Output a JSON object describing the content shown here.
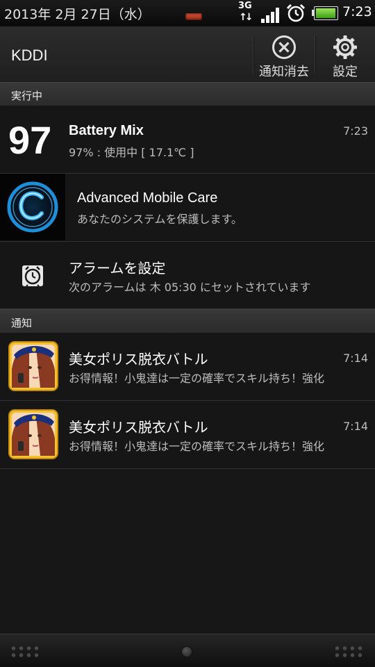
{
  "status_bar": {
    "date": "2013年 2月 27日（水）",
    "network_label": "3G",
    "time": "7:23",
    "battery_level": 0.97,
    "icons": [
      "notification-led-icon",
      "network-3g-icon",
      "signal-strength-icon",
      "alarm-clock-icon",
      "battery-icon"
    ]
  },
  "header": {
    "carrier": "KDDI",
    "clear_label": "通知消去",
    "settings_label": "設定"
  },
  "sections": {
    "running": "実行中",
    "notifications": "通知"
  },
  "running_items": [
    {
      "badge": "97",
      "title": "Battery Mix",
      "subtitle": "97% : 使用中 [ 17.1℃ ]",
      "time": "7:23"
    },
    {
      "title": "Advanced Mobile Care",
      "subtitle": "あなたのシステムを保護します。",
      "icon": "amc-c-logo-icon"
    },
    {
      "title": "アラームを設定",
      "subtitle": "次のアラームは 木 05:30 にセットされています",
      "icon": "alarm-clock-icon"
    }
  ],
  "notification_items": [
    {
      "title": "美女ポリス脱衣バトル",
      "subtitle": "お得情報！小鬼達は一定の確率でスキル持ち！強化",
      "time": "7:14",
      "icon": "game-app-icon"
    },
    {
      "title": "美女ポリス脱衣バトル",
      "subtitle": "お得情報！小鬼達は一定の確率でスキル持ち！強化",
      "time": "7:14",
      "icon": "game-app-icon"
    }
  ],
  "colors": {
    "background": "#161616",
    "accent_blue": "#2aa6f2",
    "battery_green": "#6ccf2f",
    "led_red": "#c0402a"
  }
}
